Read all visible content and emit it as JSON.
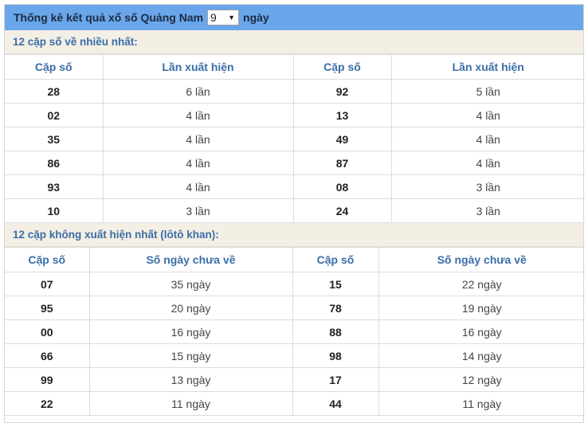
{
  "header": {
    "title": "Thống kê kết quả xổ số Quảng Nam",
    "days_selected": "9",
    "days_suffix": "ngày"
  },
  "most_frequent": {
    "title": "12 cặp số về nhiều nhất:",
    "col_pair": "Cặp số",
    "col_count": "Lần xuất hiện",
    "rows": [
      [
        "28",
        "6 lần",
        "92",
        "5 lần"
      ],
      [
        "02",
        "4 lần",
        "13",
        "4 lần"
      ],
      [
        "35",
        "4 lần",
        "49",
        "4 lần"
      ],
      [
        "86",
        "4 lần",
        "87",
        "4 lần"
      ],
      [
        "93",
        "4 lần",
        "08",
        "3 lần"
      ],
      [
        "10",
        "3 lần",
        "24",
        "3 lần"
      ]
    ]
  },
  "least_frequent": {
    "title": "12 cặp không xuất hiện nhất (lôtô khan):",
    "col_pair": "Cặp số",
    "col_days": "Số ngày chưa về",
    "rows": [
      [
        "07",
        "35 ngày",
        "15",
        "22 ngày"
      ],
      [
        "95",
        "20 ngày",
        "78",
        "19 ngày"
      ],
      [
        "00",
        "16 ngày",
        "88",
        "16 ngày"
      ],
      [
        "66",
        "15 ngày",
        "98",
        "14 ngày"
      ],
      [
        "99",
        "13 ngày",
        "17",
        "12 ngày"
      ],
      [
        "22",
        "11 ngày",
        "44",
        "11 ngày"
      ]
    ]
  }
}
